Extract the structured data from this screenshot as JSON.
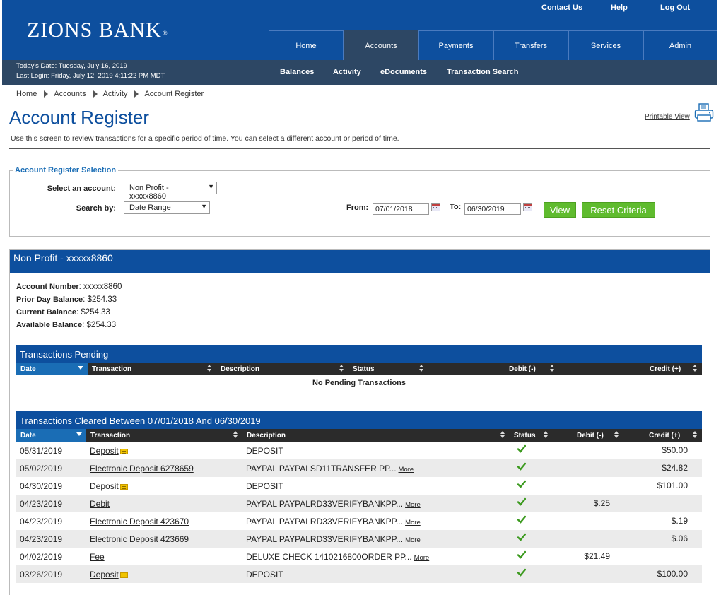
{
  "brand": {
    "logo_text": "ZIONS BANK",
    "logo_mark": "®"
  },
  "utility_links": [
    "Contact Us",
    "Help",
    "Log Out"
  ],
  "main_nav": [
    {
      "label": "Home"
    },
    {
      "label": "Accounts",
      "active": true
    },
    {
      "label": "Payments"
    },
    {
      "label": "Transfers"
    },
    {
      "label": "Services"
    },
    {
      "label": "Admin"
    }
  ],
  "session": {
    "today": "Today's Date: Tuesday, July 16, 2019",
    "last_login": "Last Login: Friday, July 12, 2019 4:11:22 PM MDT"
  },
  "sub_nav": [
    "Balances",
    "Activity",
    "eDocuments",
    "Transaction Search"
  ],
  "breadcrumb": [
    "Home",
    "Accounts",
    "Activity",
    "Account Register"
  ],
  "page": {
    "title": "Account Register",
    "printable_view": "Printable View",
    "intro": "Use this screen to review transactions for a specific period of time. You can select a different account or period of time."
  },
  "selection": {
    "legend": "Account Register Selection",
    "account_label": "Select an account:",
    "account_value": "Non Profit - xxxxx8860",
    "search_label": "Search by:",
    "search_value": "Date Range",
    "from_label": "From:",
    "from_value": "07/01/2018",
    "to_label": "To:",
    "to_value": "06/30/2019",
    "view_button": "View",
    "reset_button": "Reset Criteria"
  },
  "account": {
    "header": "Non Profit - xxxxx8860",
    "number_label": "Account Number",
    "number_value": ": xxxxx8860",
    "prior_label": "Prior Day Balance",
    "prior_value": ": $254.33",
    "current_label": "Current Balance",
    "current_value": ": $254.33",
    "available_label": "Available Balance",
    "available_value": ": $254.33"
  },
  "pending": {
    "title": "Transactions Pending",
    "columns": [
      "Date",
      "Transaction",
      "Description",
      "Status",
      "Debit (-)",
      "Credit (+)"
    ],
    "empty_text": "No Pending Transactions"
  },
  "cleared": {
    "title": "Transactions Cleared Between 07/01/2018 And 06/30/2019",
    "columns": [
      "Date",
      "Transaction",
      "Description",
      "Status",
      "Debit (-)",
      "Credit (+)"
    ],
    "more_label": "More",
    "rows": [
      {
        "date": "05/31/2019",
        "transaction": "Deposit",
        "doc_icon": true,
        "description": "DEPOSIT",
        "more": false,
        "debit": "",
        "credit": "$50.00"
      },
      {
        "date": "05/02/2019",
        "transaction": "Electronic Deposit 6278659",
        "doc_icon": false,
        "description": "PAYPAL PAYPALSD11TRANSFER PP...",
        "more": true,
        "debit": "",
        "credit": "$24.82"
      },
      {
        "date": "04/30/2019",
        "transaction": "Deposit",
        "doc_icon": true,
        "description": "DEPOSIT",
        "more": false,
        "debit": "",
        "credit": "$101.00"
      },
      {
        "date": "04/23/2019",
        "transaction": "Debit",
        "doc_icon": false,
        "description": "PAYPAL PAYPALRD33VERIFYBANKPP...",
        "more": true,
        "debit": "$.25",
        "credit": ""
      },
      {
        "date": "04/23/2019",
        "transaction": "Electronic Deposit 423670",
        "doc_icon": false,
        "description": "PAYPAL PAYPALRD33VERIFYBANKPP...",
        "more": true,
        "debit": "",
        "credit": "$.19"
      },
      {
        "date": "04/23/2019",
        "transaction": "Electronic Deposit 423669",
        "doc_icon": false,
        "description": "PAYPAL PAYPALRD33VERIFYBANKPP...",
        "more": true,
        "debit": "",
        "credit": "$.06"
      },
      {
        "date": "04/02/2019",
        "transaction": "Fee",
        "doc_icon": false,
        "description": "DELUXE CHECK 1410216800ORDER PP...",
        "more": true,
        "debit": "$21.49",
        "credit": ""
      },
      {
        "date": "03/26/2019",
        "transaction": "Deposit",
        "doc_icon": true,
        "description": "DEPOSIT",
        "more": false,
        "debit": "",
        "credit": "$100.00"
      }
    ]
  },
  "colors": {
    "brand_blue": "#0d4f9e",
    "sub_bar": "#2d4764",
    "accent_blue": "#1a6db5",
    "button_green": "#5fbb2e",
    "status_check": "#3c9a1f"
  },
  "icons": [
    "printer-icon",
    "calendar-icon",
    "sort-icon",
    "check-icon",
    "document-icon",
    "chevron-right-icon"
  ]
}
